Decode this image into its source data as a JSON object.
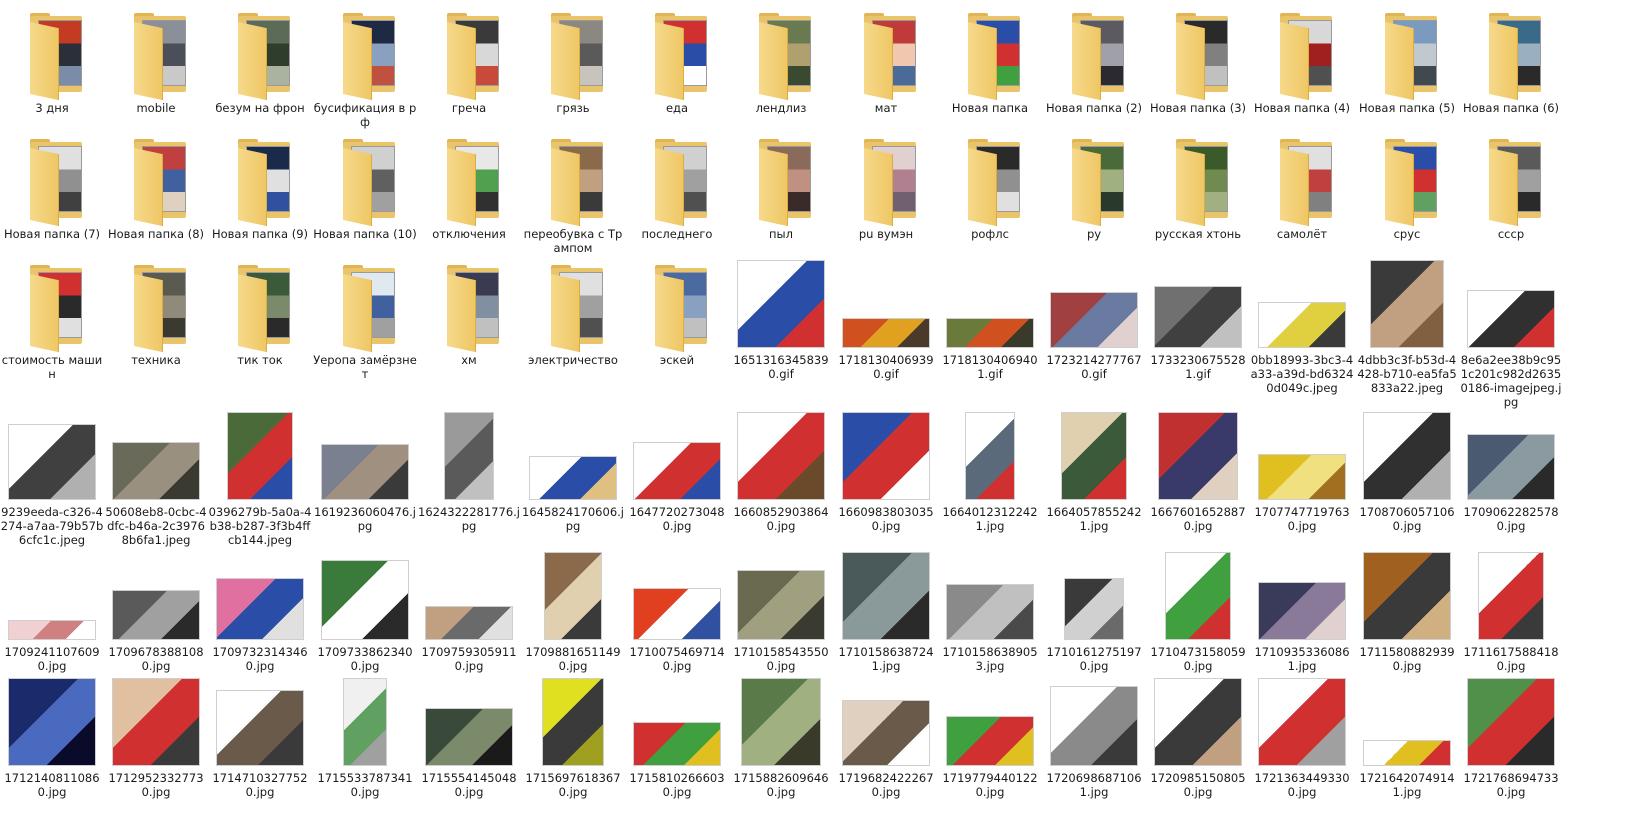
{
  "explorer": {
    "items": [
      {
        "label": "3 дня",
        "kind": "folder",
        "colors": [
          "#c23b22",
          "#2b2f3a",
          "#7a8ca8"
        ]
      },
      {
        "label": "mobile",
        "kind": "folder",
        "colors": [
          "#8a8f98",
          "#4a4f5a",
          "#c9c9c9"
        ]
      },
      {
        "label": "безум на фрон",
        "kind": "folder",
        "colors": [
          "#5b6b58",
          "#2e3d2c",
          "#a9b3a0"
        ]
      },
      {
        "label": "бусификация в рф",
        "kind": "folder",
        "colors": [
          "#1e2a44",
          "#8aa0c0",
          "#c05040"
        ]
      },
      {
        "label": "греча",
        "kind": "folder",
        "colors": [
          "#3a3a3a",
          "#d8d8d8",
          "#c84a3a"
        ]
      },
      {
        "label": "грязь",
        "kind": "folder",
        "colors": [
          "#8a8880",
          "#5a5a5a",
          "#c8c4bc"
        ]
      },
      {
        "label": "еда",
        "kind": "folder",
        "colors": [
          "#d03030",
          "#2a4ea8",
          "#ffffff"
        ]
      },
      {
        "label": "лендлиз",
        "kind": "folder",
        "colors": [
          "#6a7a50",
          "#b0a070",
          "#3a4a30"
        ]
      },
      {
        "label": "мат",
        "kind": "folder",
        "colors": [
          "#c03a3a",
          "#f0c8b0",
          "#4a6a9a"
        ]
      },
      {
        "label": "Новая папка",
        "kind": "folder",
        "colors": [
          "#2a4ea8",
          "#d03030",
          "#40a040"
        ]
      },
      {
        "label": "Новая папка (2)",
        "kind": "folder",
        "colors": [
          "#5a5a60",
          "#a0a0a8",
          "#2a2a30"
        ]
      },
      {
        "label": "Новая папка (3)",
        "kind": "folder",
        "colors": [
          "#2a2a2a",
          "#808080",
          "#c0c0c0"
        ]
      },
      {
        "label": "Новая папка (4)",
        "kind": "folder",
        "colors": [
          "#d8d8d8",
          "#a02020",
          "#505050"
        ]
      },
      {
        "label": "Новая папка (5)",
        "kind": "folder",
        "colors": [
          "#7a9ac0",
          "#c0c8d0",
          "#404850"
        ]
      },
      {
        "label": "Новая папка (6)",
        "kind": "folder",
        "colors": [
          "#3a6a8a",
          "#9ab0c0",
          "#2a2a2a"
        ]
      },
      {
        "label": "Новая папка (7)",
        "kind": "folder",
        "colors": [
          "#e0e0e0",
          "#909090",
          "#404040"
        ]
      },
      {
        "label": "Новая папка (8)",
        "kind": "folder",
        "colors": [
          "#c04040",
          "#4060a0",
          "#e0d0c0"
        ]
      },
      {
        "label": "Новая папка (9)",
        "kind": "folder",
        "colors": [
          "#1a2a4a",
          "#e0e0e0",
          "#3050a0"
        ]
      },
      {
        "label": "Новая папка (10)",
        "kind": "folder",
        "colors": [
          "#d0d0d0",
          "#606060",
          "#a0a0a0"
        ]
      },
      {
        "label": "отключения",
        "kind": "folder",
        "colors": [
          "#e8e8e8",
          "#50a050",
          "#303030"
        ]
      },
      {
        "label": "переобувка с Трампом",
        "kind": "folder",
        "colors": [
          "#8a6a4a",
          "#c0a080",
          "#3a3a3a"
        ]
      },
      {
        "label": "последнего",
        "kind": "folder",
        "colors": [
          "#d0d0d0",
          "#a0a0a0",
          "#505050"
        ]
      },
      {
        "label": "пыл",
        "kind": "folder",
        "colors": [
          "#8a6a5a",
          "#c09080",
          "#3a2a2a"
        ]
      },
      {
        "label": "pu вумэн",
        "kind": "folder",
        "colors": [
          "#e0d0d0",
          "#b08090",
          "#706070"
        ]
      },
      {
        "label": "рофлс",
        "kind": "folder",
        "colors": [
          "#2a2a2a",
          "#909090",
          "#e0e0e0"
        ]
      },
      {
        "label": "ру",
        "kind": "folder",
        "colors": [
          "#4a6a3a",
          "#a0b080",
          "#2a3a2a"
        ]
      },
      {
        "label": "русская хтонь",
        "kind": "folder",
        "colors": [
          "#3a5a2a",
          "#708a50",
          "#a0b080"
        ]
      },
      {
        "label": "самолёт",
        "kind": "folder",
        "colors": [
          "#e0e0e0",
          "#c04040",
          "#808080"
        ]
      },
      {
        "label": "срус",
        "kind": "folder",
        "colors": [
          "#2a4ea8",
          "#d03030",
          "#60a060"
        ]
      },
      {
        "label": "ссср",
        "kind": "folder",
        "colors": [
          "#5a5a5a",
          "#a0a0a0",
          "#2a2a2a"
        ]
      },
      {
        "label": "стоимость машин",
        "kind": "folder",
        "colors": [
          "#d03030",
          "#2a2a2a",
          "#e0e0e0"
        ]
      },
      {
        "label": "техника",
        "kind": "folder",
        "colors": [
          "#5a5a50",
          "#908a7a",
          "#3a3a30"
        ]
      },
      {
        "label": "тик ток",
        "kind": "folder",
        "colors": [
          "#3a5a3a",
          "#7a8a6a",
          "#2a2a2a"
        ]
      },
      {
        "label": "Уеропа замёрзнет",
        "kind": "folder",
        "colors": [
          "#e0e8f0",
          "#4060a0",
          "#a0a0a0"
        ]
      },
      {
        "label": "хм",
        "kind": "folder",
        "colors": [
          "#3a3a50",
          "#8090a0",
          "#c0c0c0"
        ]
      },
      {
        "label": "электричество",
        "kind": "folder",
        "colors": [
          "#e0e0e0",
          "#a0a0a0",
          "#505050"
        ]
      },
      {
        "label": "эскей",
        "kind": "folder",
        "colors": [
          "#4a6aa0",
          "#8aa0c0",
          "#c0c0c0"
        ]
      },
      {
        "label": "16513163458390.gif",
        "kind": "image",
        "w": 88,
        "h": 88,
        "colors": [
          "#ffffff",
          "#2a4ea8",
          "#d03030"
        ]
      },
      {
        "label": "17181304069390.gif",
        "kind": "image",
        "w": 88,
        "h": 30,
        "colors": [
          "#d05020",
          "#e0a020",
          "#4a3a2a"
        ]
      },
      {
        "label": "17181304069401.gif",
        "kind": "image",
        "w": 88,
        "h": 30,
        "colors": [
          "#6a7a3a",
          "#d05020",
          "#3a3a2a"
        ]
      },
      {
        "label": "17232142777670.gif",
        "kind": "image",
        "w": 88,
        "h": 56,
        "colors": [
          "#a04040",
          "#6a7aa0",
          "#e0d0d0"
        ]
      },
      {
        "label": "17332306755281.gif",
        "kind": "image",
        "w": 88,
        "h": 62,
        "colors": [
          "#707070",
          "#404040",
          "#c0c0c0"
        ]
      },
      {
        "label": "0bb18993-3bc3-4a33-a39d-bd63240d049c.jpeg",
        "kind": "image",
        "w": 88,
        "h": 46,
        "colors": [
          "#ffffff",
          "#e0d040",
          "#3a3a3a"
        ]
      },
      {
        "label": "4dbb3c3f-b53d-4428-b710-ea5fa5833a22.jpeg",
        "kind": "image",
        "w": 74,
        "h": 88,
        "colors": [
          "#3a3a3a",
          "#c0a080",
          "#806040"
        ]
      },
      {
        "label": "8e6a2ee38b9c951c201c982d26350186-imagejpeg.jpg",
        "kind": "image",
        "w": 88,
        "h": 58,
        "colors": [
          "#ffffff",
          "#303030",
          "#d03030"
        ]
      },
      {
        "label": "9239eeda-c326-4274-a7aa-79b57b6cfc1c.jpeg",
        "kind": "image",
        "w": 88,
        "h": 76,
        "colors": [
          "#ffffff",
          "#404040",
          "#b0b0b0"
        ]
      },
      {
        "label": "50608eb8-0cbc-4dfc-b46a-2c39768b6fa1.jpeg",
        "kind": "image",
        "w": 88,
        "h": 58,
        "colors": [
          "#6a6a5a",
          "#9a9080",
          "#3a3a30"
        ]
      },
      {
        "label": "0396279b-5a0a-4b38-b287-3f3b4ffcb144.jpeg",
        "kind": "image",
        "w": 66,
        "h": 88,
        "colors": [
          "#4a6a3a",
          "#d03030",
          "#2a4ea8"
        ]
      },
      {
        "label": "1619236060476.jpg",
        "kind": "image",
        "w": 88,
        "h": 56,
        "colors": [
          "#7a8090",
          "#a09080",
          "#3a3a3a"
        ]
      },
      {
        "label": "1624322281776.jpg",
        "kind": "image",
        "w": 50,
        "h": 88,
        "colors": [
          "#9a9a9a",
          "#5a5a5a",
          "#c0c0c0"
        ]
      },
      {
        "label": "1645824170606.jpg",
        "kind": "image",
        "w": 88,
        "h": 44,
        "colors": [
          "#ffffff",
          "#2a4ea8",
          "#e0c080"
        ]
      },
      {
        "label": "16477202730480.jpg",
        "kind": "image",
        "w": 88,
        "h": 58,
        "colors": [
          "#ffffff",
          "#d03030",
          "#2a4ea8"
        ]
      },
      {
        "label": "16608529038640.jpg",
        "kind": "image",
        "w": 88,
        "h": 88,
        "colors": [
          "#ffffff",
          "#d03030",
          "#6a4a2a"
        ]
      },
      {
        "label": "16609838030350.jpg",
        "kind": "image",
        "w": 88,
        "h": 88,
        "colors": [
          "#2a4ea8",
          "#d03030",
          "#ffffff"
        ]
      },
      {
        "label": "16640123122421.jpg",
        "kind": "image",
        "w": 50,
        "h": 88,
        "colors": [
          "#ffffff",
          "#5a6a7a",
          "#d03030"
        ]
      },
      {
        "label": "16640578552421.jpg",
        "kind": "image",
        "w": 66,
        "h": 88,
        "colors": [
          "#e0d0b0",
          "#3a5a3a",
          "#d03030"
        ]
      },
      {
        "label": "16676016528870.jpg",
        "kind": "image",
        "w": 80,
        "h": 88,
        "colors": [
          "#c03030",
          "#3a3a6a",
          "#e0d0c0"
        ]
      },
      {
        "label": "17077477197630.jpg",
        "kind": "image",
        "w": 88,
        "h": 46,
        "colors": [
          "#e0c020",
          "#f0e080",
          "#a07020"
        ]
      },
      {
        "label": "17087060571060.jpg",
        "kind": "image",
        "w": 88,
        "h": 88,
        "colors": [
          "#ffffff",
          "#303030",
          "#b0b0b0"
        ]
      },
      {
        "label": "17090622825780.jpg",
        "kind": "image",
        "w": 88,
        "h": 66,
        "colors": [
          "#4a5a70",
          "#8a9aa0",
          "#2a2a2a"
        ]
      },
      {
        "label": "17092411076090.jpg",
        "kind": "image",
        "w": 88,
        "h": 20,
        "colors": [
          "#f0d0d0",
          "#d08080",
          "#ffffff"
        ]
      },
      {
        "label": "17096783881080.jpg",
        "kind": "image",
        "w": 88,
        "h": 50,
        "colors": [
          "#5a5a5a",
          "#a0a0a0",
          "#2a2a2a"
        ]
      },
      {
        "label": "17097323143460.jpg",
        "kind": "image",
        "w": 88,
        "h": 62,
        "colors": [
          "#e070a0",
          "#2a4ea8",
          "#e0e0e0"
        ]
      },
      {
        "label": "17097338623400.jpg",
        "kind": "image",
        "w": 88,
        "h": 80,
        "colors": [
          "#3a7a3a",
          "#ffffff",
          "#2a2a2a"
        ]
      },
      {
        "label": "17097593059110.jpg",
        "kind": "image",
        "w": 88,
        "h": 34,
        "colors": [
          "#c0a080",
          "#6a6a6a",
          "#e0e0e0"
        ]
      },
      {
        "label": "17098816511490.jpg",
        "kind": "image",
        "w": 58,
        "h": 88,
        "colors": [
          "#8a6a4a",
          "#e0d0b0",
          "#3a3a3a"
        ]
      },
      {
        "label": "17100754697140.jpg",
        "kind": "image",
        "w": 88,
        "h": 52,
        "colors": [
          "#e04020",
          "#ffffff",
          "#3050a0"
        ]
      },
      {
        "label": "17101585435500.jpg",
        "kind": "image",
        "w": 88,
        "h": 70,
        "colors": [
          "#6a6a50",
          "#a0a080",
          "#3a3a30"
        ]
      },
      {
        "label": "17101586387241.jpg",
        "kind": "image",
        "w": 88,
        "h": 88,
        "colors": [
          "#4a5a5a",
          "#8a9a9a",
          "#2a2a2a"
        ]
      },
      {
        "label": "17101586389053.jpg",
        "kind": "image",
        "w": 88,
        "h": 56,
        "colors": [
          "#8a8a8a",
          "#c0c0c0",
          "#4a4a4a"
        ]
      },
      {
        "label": "17101612751970.jpg",
        "kind": "image",
        "w": 60,
        "h": 62,
        "colors": [
          "#3a3a3a",
          "#d0d0d0",
          "#6a6a6a"
        ]
      },
      {
        "label": "17104731580590.jpg",
        "kind": "image",
        "w": 66,
        "h": 88,
        "colors": [
          "#ffffff",
          "#40a040",
          "#d03030"
        ]
      },
      {
        "label": "17109353360861.jpg",
        "kind": "image",
        "w": 88,
        "h": 58,
        "colors": [
          "#3a3a5a",
          "#8a7a9a",
          "#e0d0d0"
        ]
      },
      {
        "label": "17115808829390.jpg",
        "kind": "image",
        "w": 88,
        "h": 88,
        "colors": [
          "#a06020",
          "#3a3a3a",
          "#d0b080"
        ]
      },
      {
        "label": "17116175884180.jpg",
        "kind": "image",
        "w": 66,
        "h": 88,
        "colors": [
          "#ffffff",
          "#d03030",
          "#3a3a3a"
        ]
      },
      {
        "label": "17121408110860.jpg",
        "kind": "image",
        "w": 88,
        "h": 88,
        "colors": [
          "#1a2a6a",
          "#4a6ac0",
          "#0a0a2a"
        ]
      },
      {
        "label": "17129523327730.jpg",
        "kind": "image",
        "w": 88,
        "h": 88,
        "colors": [
          "#e0c0a0",
          "#d03030",
          "#3a3a3a"
        ]
      },
      {
        "label": "17147103277520.jpg",
        "kind": "image",
        "w": 88,
        "h": 76,
        "colors": [
          "#ffffff",
          "#6a5a4a",
          "#3a3a3a"
        ]
      },
      {
        "label": "17155337873410.jpg",
        "kind": "image",
        "w": 44,
        "h": 88,
        "colors": [
          "#f0f0f0",
          "#60a060",
          "#a0a0a0"
        ]
      },
      {
        "label": "17155541450480.jpg",
        "kind": "image",
        "w": 88,
        "h": 58,
        "colors": [
          "#3a4a3a",
          "#7a8a6a",
          "#1a1a1a"
        ]
      },
      {
        "label": "17156976183670.jpg",
        "kind": "image",
        "w": 62,
        "h": 88,
        "colors": [
          "#e0e020",
          "#3a3a3a",
          "#a0a020"
        ]
      },
      {
        "label": "17158102666030.jpg",
        "kind": "image",
        "w": 88,
        "h": 44,
        "colors": [
          "#d03030",
          "#40a040",
          "#e0c020"
        ]
      },
      {
        "label": "17158826096460.jpg",
        "kind": "image",
        "w": 80,
        "h": 88,
        "colors": [
          "#5a7a4a",
          "#a0b080",
          "#3a3a2a"
        ]
      },
      {
        "label": "17196824222670.jpg",
        "kind": "image",
        "w": 88,
        "h": 66,
        "colors": [
          "#e0d0c0",
          "#6a5a4a",
          "#ffffff"
        ]
      },
      {
        "label": "17197794401220.jpg",
        "kind": "image",
        "w": 88,
        "h": 50,
        "colors": [
          "#40a040",
          "#d03030",
          "#e0c020"
        ]
      },
      {
        "label": "17206986871061.jpg",
        "kind": "image",
        "w": 88,
        "h": 80,
        "colors": [
          "#ffffff",
          "#8a8a8a",
          "#3a3a3a"
        ]
      },
      {
        "label": "17209851508050.jpg",
        "kind": "image",
        "w": 88,
        "h": 88,
        "colors": [
          "#ffffff",
          "#3a3a3a",
          "#c0a080"
        ]
      },
      {
        "label": "17213634493300.jpg",
        "kind": "image",
        "w": 88,
        "h": 88,
        "colors": [
          "#ffffff",
          "#d03030",
          "#a0a0a0"
        ]
      },
      {
        "label": "17216420749141.jpg",
        "kind": "image",
        "w": 88,
        "h": 26,
        "colors": [
          "#ffffff",
          "#e0c020",
          "#d03030"
        ]
      },
      {
        "label": "17217686947330.jpg",
        "kind": "image",
        "w": 88,
        "h": 88,
        "colors": [
          "#50904a",
          "#d03030",
          "#2a2a2a"
        ]
      }
    ]
  }
}
